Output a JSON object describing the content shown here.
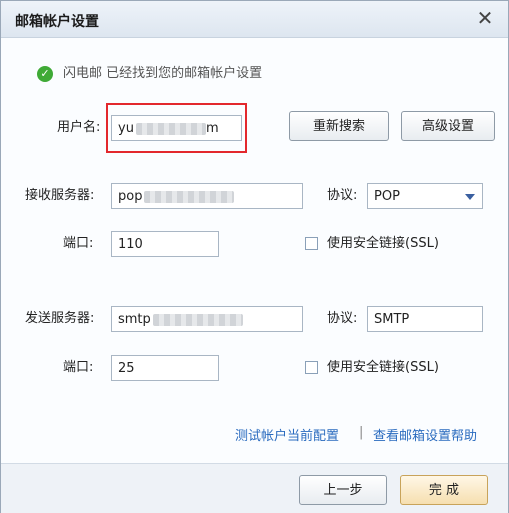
{
  "window": {
    "title": "邮箱帐户设置",
    "close_glyph": "✕"
  },
  "status": {
    "icon": "check-circle-icon",
    "text": "闪电邮 已经找到您的邮箱帐户设置"
  },
  "username": {
    "label": "用户名:",
    "value_prefix": "yu",
    "value_suffix": "m"
  },
  "buttons": {
    "research": "重新搜索",
    "advanced": "高级设置",
    "back": "上一步",
    "finish": "完 成"
  },
  "incoming": {
    "label": "接收服务器:",
    "server_prefix": "pop",
    "protocol_label": "协议:",
    "protocol_value": "POP",
    "port_label": "端口:",
    "port_value": "110",
    "ssl_label": "使用安全链接(SSL)"
  },
  "outgoing": {
    "label": "发送服务器:",
    "server_prefix": "smtp",
    "protocol_label": "协议:",
    "protocol_value": "SMTP",
    "port_label": "端口:",
    "port_value": "25",
    "ssl_label": "使用安全链接(SSL)"
  },
  "links": {
    "test": "测试帐户当前配置",
    "separator": "|",
    "help": "查看邮箱设置帮助"
  },
  "colors": {
    "highlight": "#e3282d",
    "link": "#2a6bbf",
    "status_ok": "#3faa36"
  }
}
